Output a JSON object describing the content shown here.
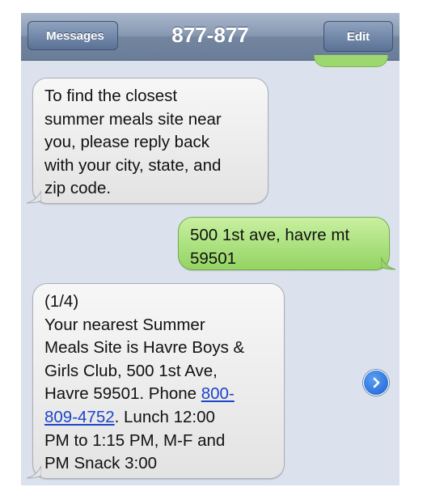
{
  "navbar": {
    "back_label": "Messages",
    "title": "877-877",
    "edit_label": "Edit"
  },
  "messages": [
    {
      "sender": "incoming",
      "text": "To find the closest\nsummer meals site near\nyou, please reply back\nwith your city, state, and\nzip code."
    },
    {
      "sender": "outgoing",
      "text": "500 1st ave, havre mt\n59501"
    },
    {
      "sender": "incoming",
      "text_before_link": "(1/4)\nYour nearest Summer\nMeals Site is Havre Boys &\nGirls Club, 500 1st Ave,\nHavre 59501. Phone ",
      "link_part1": "800-",
      "link_part2": "809-4752",
      "text_after_link": ". Lunch 12:00\nPM to 1:15 PM, M-F and\nPM Snack 3:00"
    }
  ],
  "icons": {
    "back": "chevron-left-icon",
    "more": "chevron-right-circle-icon"
  },
  "colors": {
    "navbar": "#7f91ab",
    "background": "#dbe2ed",
    "incoming_bubble": "#ececec",
    "outgoing_bubble": "#a8dc78",
    "link": "#1d44c9",
    "arrow_button": "#2f74e0"
  }
}
